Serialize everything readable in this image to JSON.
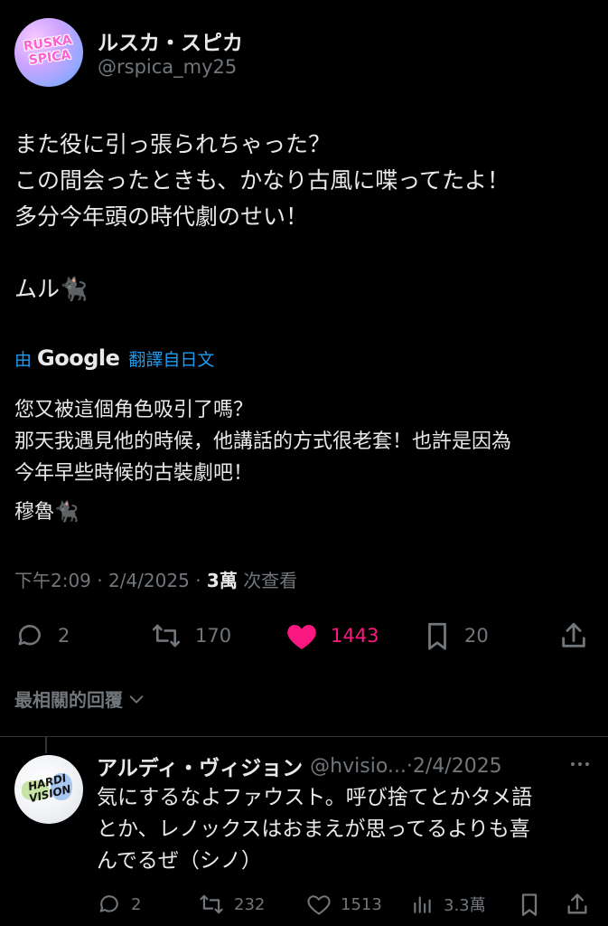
{
  "author": {
    "display_name": "ルスカ・スピカ",
    "handle": "@rspica_my25",
    "avatar_text": "RUSKA SPICA"
  },
  "tweet": {
    "lines": [
      "また役に引っ張られちゃった？",
      "この間会ったときも、かなり古風に喋ってたよ！",
      "多分今年頭の時代劇のせい！",
      "ムル🐈‍⬛"
    ]
  },
  "translation": {
    "by_label": "由",
    "provider": "Google",
    "from_label": "翻譯自日文",
    "lines": [
      "您又被這個角色吸引了嗎？",
      "那天我遇見他的時候，他講話的方式很老套！也許是因為",
      "今年早些時候的古裝劇吧！",
      "穆魯🐈‍⬛"
    ]
  },
  "meta": {
    "time": "下午2:09",
    "date": "2/4/2025",
    "views_count": "3萬",
    "views_label": "次查看",
    "separator": "·"
  },
  "actions": {
    "replies": "2",
    "reposts": "170",
    "likes": "1443",
    "bookmarks": "20"
  },
  "replies_section": {
    "title": "最相關的回覆"
  },
  "reply": {
    "display_name": "アルディ・ヴィジョン",
    "handle": "@hvisio...",
    "separator": "·",
    "date": "2/4/2025",
    "avatar_text": "HARDI VISION",
    "lines": [
      "気にするなよファウスト。呼び捨てとかタメ語",
      "とか、レノックスはおまえが思ってるよりも喜",
      "んでるぜ（シノ）"
    ],
    "actions": {
      "replies": "2",
      "reposts": "232",
      "likes": "1513",
      "views": "3.3萬"
    }
  },
  "colors": {
    "background": "#000000",
    "text": "#e7e9ea",
    "secondary": "#71767b",
    "link": "#1d9bf0",
    "like": "#f91880",
    "divider": "#2f3336"
  }
}
